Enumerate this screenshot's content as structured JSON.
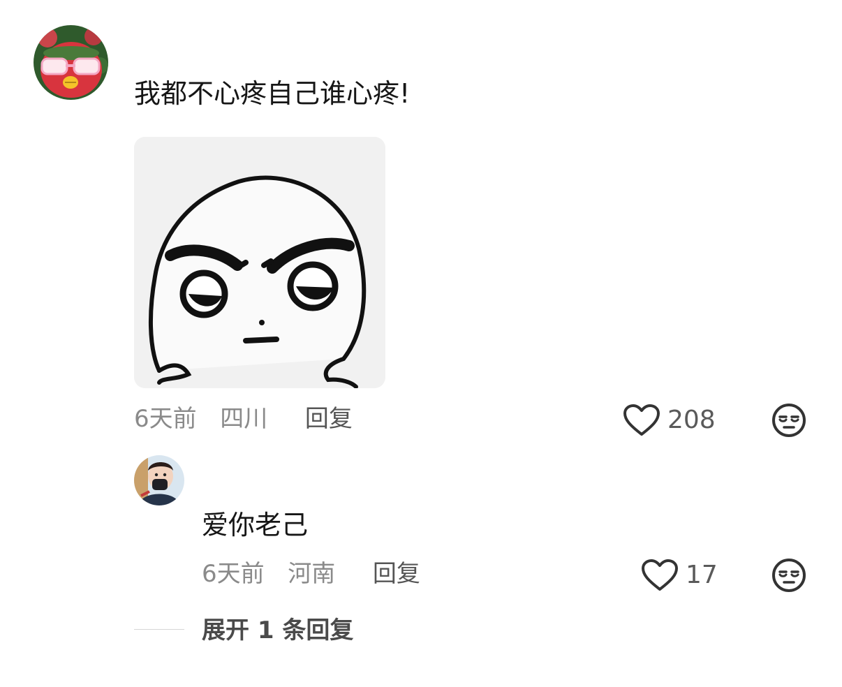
{
  "main_comment": {
    "text": "我都不心疼自己谁心疼!",
    "time": "6天前",
    "location": "四川",
    "reply_label": "回复",
    "likes": "208"
  },
  "reply_comment": {
    "text": "爱你老己",
    "time": "6天前",
    "location": "河南",
    "reply_label": "回复",
    "likes": "17"
  },
  "expand_replies": "展开 1 条回复",
  "colors": {
    "text_primary": "#161616",
    "text_meta": "#8a8a8a",
    "icon": "#333333",
    "background": "#ffffff"
  },
  "icons": {
    "like": "heart-outline-icon",
    "dislike": "unamused-face-icon"
  }
}
